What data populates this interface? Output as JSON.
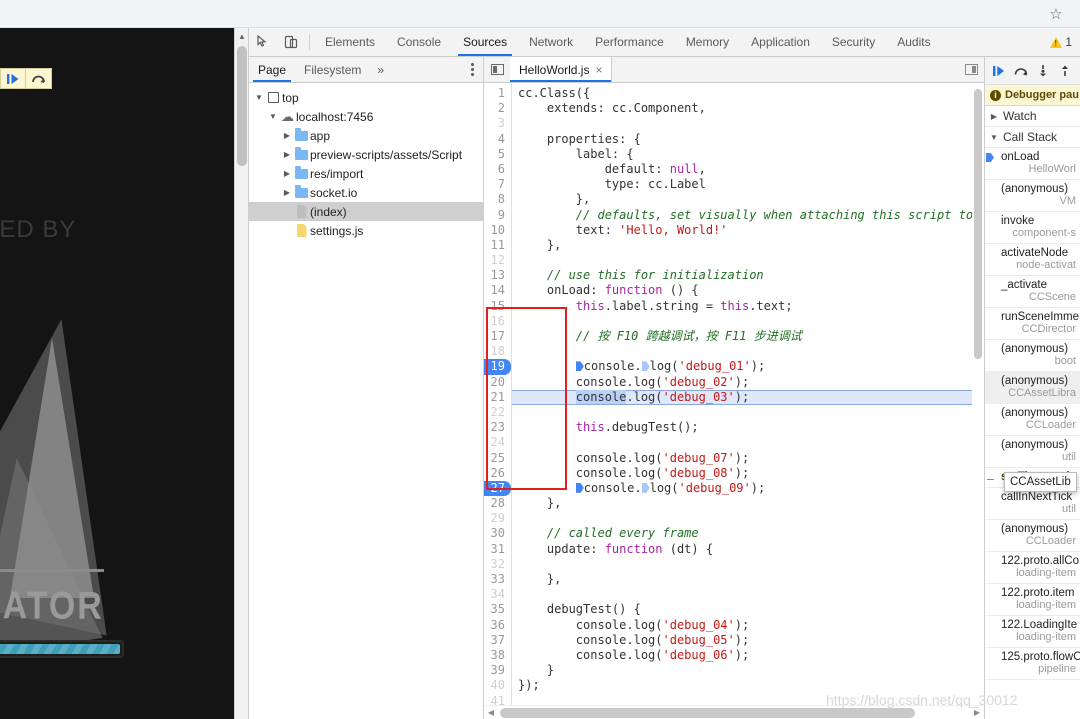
{
  "browser": {
    "star_icon": "star-icon"
  },
  "game": {
    "powered_by": "ERED BY",
    "brand": "EATOR",
    "progress_percent": 100,
    "mini_toolbar": [
      {
        "icon": "resume-icon"
      },
      {
        "icon": "step-over-icon"
      }
    ]
  },
  "devtools": {
    "left_icons": [
      {
        "name": "inspect-element-icon"
      },
      {
        "name": "device-toolbar-icon"
      }
    ],
    "tabs": [
      {
        "label": "Elements",
        "active": false
      },
      {
        "label": "Console",
        "active": false
      },
      {
        "label": "Sources",
        "active": true
      },
      {
        "label": "Network",
        "active": false
      },
      {
        "label": "Performance",
        "active": false
      },
      {
        "label": "Memory",
        "active": false
      },
      {
        "label": "Application",
        "active": false
      },
      {
        "label": "Security",
        "active": false
      },
      {
        "label": "Audits",
        "active": false
      }
    ],
    "warning_count": "1"
  },
  "navigator": {
    "subtabs": [
      {
        "label": "Page",
        "active": true
      },
      {
        "label": "Filesystem",
        "active": false
      }
    ],
    "more_label": "»",
    "tree": [
      {
        "label": "top",
        "indent": 0,
        "twisty": "▼",
        "icon": "box",
        "selected": false
      },
      {
        "label": "localhost:7456",
        "indent": 1,
        "twisty": "▼",
        "icon": "cloud",
        "selected": false
      },
      {
        "label": "app",
        "indent": 2,
        "twisty": "▶",
        "icon": "folder",
        "selected": false
      },
      {
        "label": "preview-scripts/assets/Script",
        "indent": 2,
        "twisty": "▶",
        "icon": "folder",
        "selected": false
      },
      {
        "label": "res/import",
        "indent": 2,
        "twisty": "▶",
        "icon": "folder",
        "selected": false
      },
      {
        "label": "socket.io",
        "indent": 2,
        "twisty": "▶",
        "icon": "folder",
        "selected": false
      },
      {
        "label": "(index)",
        "indent": 2,
        "twisty": "",
        "icon": "doc",
        "selected": true
      },
      {
        "label": "settings.js",
        "indent": 2,
        "twisty": "",
        "icon": "docy",
        "selected": false
      }
    ]
  },
  "editor": {
    "tab_label": "HelloWorld.js",
    "tab_close": "×",
    "lines": [
      {
        "n": "1",
        "exec": false,
        "bp": false,
        "blank": false,
        "tokens": [
          {
            "t": "cc.Class({",
            "c": ""
          }
        ]
      },
      {
        "n": "2",
        "exec": false,
        "bp": false,
        "blank": false,
        "tokens": [
          {
            "t": "    extends: cc.Component,",
            "c": ""
          }
        ]
      },
      {
        "n": "3",
        "exec": false,
        "bp": false,
        "blank": true,
        "tokens": []
      },
      {
        "n": "4",
        "exec": false,
        "bp": false,
        "blank": false,
        "tokens": [
          {
            "t": "    properties: {",
            "c": ""
          }
        ]
      },
      {
        "n": "5",
        "exec": false,
        "bp": false,
        "blank": false,
        "tokens": [
          {
            "t": "        label: {",
            "c": ""
          }
        ]
      },
      {
        "n": "6",
        "exec": false,
        "bp": false,
        "blank": false,
        "tokens": [
          {
            "t": "            default: ",
            "c": ""
          },
          {
            "t": "null",
            "c": "kw"
          },
          {
            "t": ",",
            "c": ""
          }
        ]
      },
      {
        "n": "7",
        "exec": false,
        "bp": false,
        "blank": false,
        "tokens": [
          {
            "t": "            type: cc.Label",
            "c": ""
          }
        ]
      },
      {
        "n": "8",
        "exec": false,
        "bp": false,
        "blank": false,
        "tokens": [
          {
            "t": "        },",
            "c": ""
          }
        ]
      },
      {
        "n": "9",
        "exec": false,
        "bp": false,
        "blank": false,
        "tokens": [
          {
            "t": "        // defaults, set visually when attaching this script to the Canv",
            "c": "com"
          }
        ]
      },
      {
        "n": "10",
        "exec": false,
        "bp": false,
        "blank": false,
        "tokens": [
          {
            "t": "        text: ",
            "c": ""
          },
          {
            "t": "'Hello, World!'",
            "c": "str"
          }
        ]
      },
      {
        "n": "11",
        "exec": false,
        "bp": false,
        "blank": false,
        "tokens": [
          {
            "t": "    },",
            "c": ""
          }
        ]
      },
      {
        "n": "12",
        "exec": false,
        "bp": false,
        "blank": true,
        "tokens": []
      },
      {
        "n": "13",
        "exec": false,
        "bp": false,
        "blank": false,
        "tokens": [
          {
            "t": "    // use this for initialization",
            "c": "com"
          }
        ]
      },
      {
        "n": "14",
        "exec": false,
        "bp": false,
        "blank": false,
        "tokens": [
          {
            "t": "    onLoad: ",
            "c": ""
          },
          {
            "t": "function",
            "c": "kw"
          },
          {
            "t": " () {",
            "c": ""
          }
        ]
      },
      {
        "n": "15",
        "exec": false,
        "bp": false,
        "blank": false,
        "tokens": [
          {
            "t": "        ",
            "c": ""
          },
          {
            "t": "this",
            "c": "kw"
          },
          {
            "t": ".label.string = ",
            "c": ""
          },
          {
            "t": "this",
            "c": "kw"
          },
          {
            "t": ".text;",
            "c": ""
          }
        ]
      },
      {
        "n": "16",
        "exec": false,
        "bp": false,
        "blank": true,
        "tokens": []
      },
      {
        "n": "17",
        "exec": false,
        "bp": false,
        "blank": false,
        "tokens": [
          {
            "t": "        // 按 F10 跨越调试，按 F11 步进调试",
            "c": "com"
          }
        ]
      },
      {
        "n": "18",
        "exec": false,
        "bp": false,
        "blank": true,
        "tokens": []
      },
      {
        "n": "19",
        "exec": false,
        "bp": true,
        "blank": false,
        "tokens": [
          {
            "t": "        ",
            "c": ""
          },
          {
            "t": "▸",
            "c": "bp"
          },
          {
            "t": "console.",
            "c": ""
          },
          {
            "t": "▸",
            "c": "bplight"
          },
          {
            "t": "log(",
            "c": ""
          },
          {
            "t": "'debug_01'",
            "c": "str"
          },
          {
            "t": ");",
            "c": ""
          }
        ]
      },
      {
        "n": "20",
        "exec": false,
        "bp": false,
        "blank": false,
        "tokens": [
          {
            "t": "        console.log(",
            "c": ""
          },
          {
            "t": "'debug_02'",
            "c": "str"
          },
          {
            "t": ");",
            "c": ""
          }
        ]
      },
      {
        "n": "21",
        "exec": true,
        "bp": false,
        "blank": false,
        "tokens": [
          {
            "t": "        ",
            "c": ""
          },
          {
            "t": "console",
            "c": "sel"
          },
          {
            "t": ".log(",
            "c": ""
          },
          {
            "t": "'debug_03'",
            "c": "str"
          },
          {
            "t": ");",
            "c": ""
          }
        ]
      },
      {
        "n": "22",
        "exec": false,
        "bp": false,
        "blank": true,
        "tokens": []
      },
      {
        "n": "23",
        "exec": false,
        "bp": false,
        "blank": false,
        "tokens": [
          {
            "t": "        ",
            "c": ""
          },
          {
            "t": "this",
            "c": "kw"
          },
          {
            "t": ".debugTest();",
            "c": ""
          }
        ]
      },
      {
        "n": "24",
        "exec": false,
        "bp": false,
        "blank": true,
        "tokens": []
      },
      {
        "n": "25",
        "exec": false,
        "bp": false,
        "blank": false,
        "tokens": [
          {
            "t": "        console.log(",
            "c": ""
          },
          {
            "t": "'debug_07'",
            "c": "str"
          },
          {
            "t": ");",
            "c": ""
          }
        ]
      },
      {
        "n": "26",
        "exec": false,
        "bp": false,
        "blank": false,
        "tokens": [
          {
            "t": "        console.log(",
            "c": ""
          },
          {
            "t": "'debug_08'",
            "c": "str"
          },
          {
            "t": ");",
            "c": ""
          }
        ]
      },
      {
        "n": "27",
        "exec": false,
        "bp": true,
        "blank": false,
        "tokens": [
          {
            "t": "        ",
            "c": ""
          },
          {
            "t": "▸",
            "c": "bp"
          },
          {
            "t": "console.",
            "c": ""
          },
          {
            "t": "▸",
            "c": "bplight"
          },
          {
            "t": "log(",
            "c": ""
          },
          {
            "t": "'debug_09'",
            "c": "str"
          },
          {
            "t": ");",
            "c": ""
          }
        ]
      },
      {
        "n": "28",
        "exec": false,
        "bp": false,
        "blank": false,
        "tokens": [
          {
            "t": "    },",
            "c": ""
          }
        ]
      },
      {
        "n": "29",
        "exec": false,
        "bp": false,
        "blank": true,
        "tokens": []
      },
      {
        "n": "30",
        "exec": false,
        "bp": false,
        "blank": false,
        "tokens": [
          {
            "t": "    // called every frame",
            "c": "com"
          }
        ]
      },
      {
        "n": "31",
        "exec": false,
        "bp": false,
        "blank": false,
        "tokens": [
          {
            "t": "    update: ",
            "c": ""
          },
          {
            "t": "function",
            "c": "kw"
          },
          {
            "t": " (dt) {",
            "c": ""
          }
        ]
      },
      {
        "n": "32",
        "exec": false,
        "bp": false,
        "blank": true,
        "tokens": []
      },
      {
        "n": "33",
        "exec": false,
        "bp": false,
        "blank": false,
        "tokens": [
          {
            "t": "    },",
            "c": ""
          }
        ]
      },
      {
        "n": "34",
        "exec": false,
        "bp": false,
        "blank": true,
        "tokens": []
      },
      {
        "n": "35",
        "exec": false,
        "bp": false,
        "blank": false,
        "tokens": [
          {
            "t": "    debugTest() {",
            "c": ""
          }
        ]
      },
      {
        "n": "36",
        "exec": false,
        "bp": false,
        "blank": false,
        "tokens": [
          {
            "t": "        console.log(",
            "c": ""
          },
          {
            "t": "'debug_04'",
            "c": "str"
          },
          {
            "t": ");",
            "c": ""
          }
        ]
      },
      {
        "n": "37",
        "exec": false,
        "bp": false,
        "blank": false,
        "tokens": [
          {
            "t": "        console.log(",
            "c": ""
          },
          {
            "t": "'debug_05'",
            "c": "str"
          },
          {
            "t": ");",
            "c": ""
          }
        ]
      },
      {
        "n": "38",
        "exec": false,
        "bp": false,
        "blank": false,
        "tokens": [
          {
            "t": "        console.log(",
            "c": ""
          },
          {
            "t": "'debug_06'",
            "c": "str"
          },
          {
            "t": ");",
            "c": ""
          }
        ]
      },
      {
        "n": "39",
        "exec": false,
        "bp": false,
        "blank": false,
        "tokens": [
          {
            "t": "    }",
            "c": ""
          }
        ]
      },
      {
        "n": "40",
        "exec": false,
        "bp": false,
        "blank": true,
        "tokens": [
          {
            "t": "});",
            "c": ""
          }
        ]
      },
      {
        "n": "41",
        "exec": false,
        "bp": false,
        "blank": true,
        "tokens": []
      }
    ]
  },
  "debugger": {
    "toolbar": [
      {
        "name": "resume-script-icon"
      },
      {
        "name": "step-over-icon"
      },
      {
        "name": "step-into-icon"
      },
      {
        "name": "step-out-icon"
      }
    ],
    "paused_banner": "Debugger pau",
    "watch_label": "Watch",
    "watch_twisty": "▶",
    "callstack_label": "Call Stack",
    "callstack_twisty": "▼",
    "tooltip": "CCAssetLib",
    "frames": [
      {
        "fn": "onLoad",
        "src": "HelloWorl",
        "current": true,
        "selected": false,
        "async": false
      },
      {
        "fn": "(anonymous)",
        "src": "VM",
        "current": false,
        "selected": false,
        "async": false
      },
      {
        "fn": "invoke",
        "src": "component-s",
        "current": false,
        "selected": false,
        "async": false
      },
      {
        "fn": "activateNode",
        "src": "node-activat",
        "current": false,
        "selected": false,
        "async": false
      },
      {
        "fn": "_activate",
        "src": "CCScene",
        "current": false,
        "selected": false,
        "async": false
      },
      {
        "fn": "runSceneImme",
        "src": "CCDirector",
        "current": false,
        "selected": false,
        "async": false
      },
      {
        "fn": "(anonymous)",
        "src": "boot",
        "current": false,
        "selected": false,
        "async": false
      },
      {
        "fn": "(anonymous)",
        "src": "CCAssetLibra",
        "current": false,
        "selected": true,
        "async": false
      },
      {
        "fn": "(anonymous)",
        "src": "CCLoader",
        "current": false,
        "selected": false,
        "async": false
      },
      {
        "fn": "(anonymous)",
        "src": "util",
        "current": false,
        "selected": false,
        "async": false
      },
      {
        "fn": "setTimeout (a",
        "src": "",
        "current": false,
        "selected": false,
        "async": true
      },
      {
        "fn": "callInNextTick",
        "src": "util",
        "current": false,
        "selected": false,
        "async": false
      },
      {
        "fn": "(anonymous)",
        "src": "CCLoader",
        "current": false,
        "selected": false,
        "async": false
      },
      {
        "fn": "122.proto.allCo",
        "src": "loading-item",
        "current": false,
        "selected": false,
        "async": false
      },
      {
        "fn": "122.proto.item",
        "src": "loading-item",
        "current": false,
        "selected": false,
        "async": false
      },
      {
        "fn": "122.LoadingIte",
        "src": "loading-item",
        "current": false,
        "selected": false,
        "async": false
      },
      {
        "fn": "125.proto.flowO",
        "src": "pipeline",
        "current": false,
        "selected": false,
        "async": false
      }
    ]
  },
  "watermark": "https://blog.csdn.net/qq_30012"
}
